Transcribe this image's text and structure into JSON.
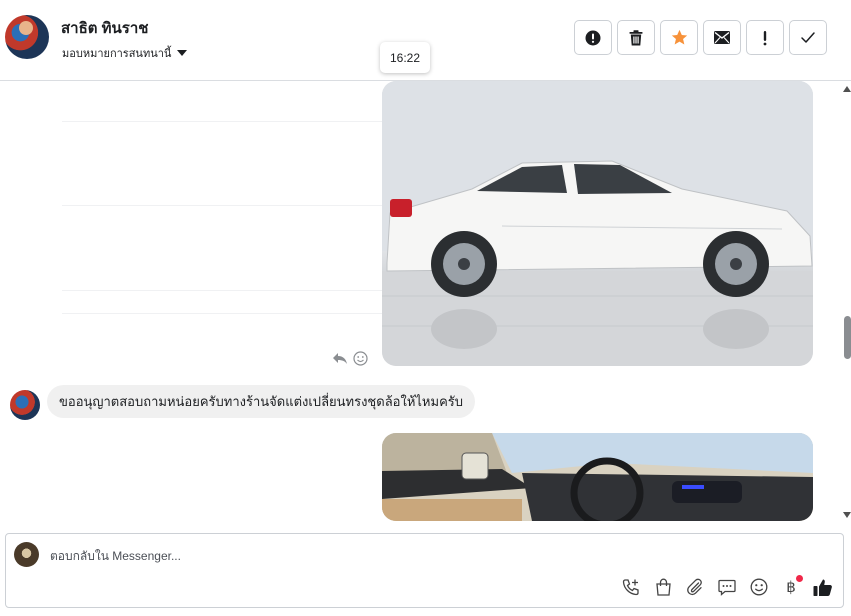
{
  "header": {
    "user_name": "สาธิต ทินราช",
    "assign_label": "มอบหมายการสนทนานี้",
    "timestamp_tooltip": "16:22",
    "actions": [
      {
        "name": "spam-button",
        "icon": "alert-circle-icon"
      },
      {
        "name": "delete-button",
        "icon": "trash-icon"
      },
      {
        "name": "star-button",
        "icon": "star-icon"
      },
      {
        "name": "mark-unread-button",
        "icon": "envelope-icon"
      },
      {
        "name": "follow-up-button",
        "icon": "exclamation-icon"
      },
      {
        "name": "mark-done-button",
        "icon": "check-icon"
      }
    ],
    "star_color": "#f7923a"
  },
  "conversation": {
    "message_text": "ขออนุญาตสอบถามหน่อยครับทางร้านจัดแต่งเปลี่ยนทรงชุดล้อให้ไหมครับ",
    "image_1": "white-sedan-side-view",
    "image_2": "car-interior-dashboard"
  },
  "composer": {
    "placeholder": "ตอบกลับใน Messenger...",
    "tools": [
      "phone-plus-icon",
      "shopping-bag-icon",
      "paperclip-icon",
      "speech-bubble-icon",
      "smiley-icon",
      "baht-icon",
      "thumbs-up-icon"
    ],
    "baht_symbol": "฿",
    "notification_color": "#f02849"
  }
}
